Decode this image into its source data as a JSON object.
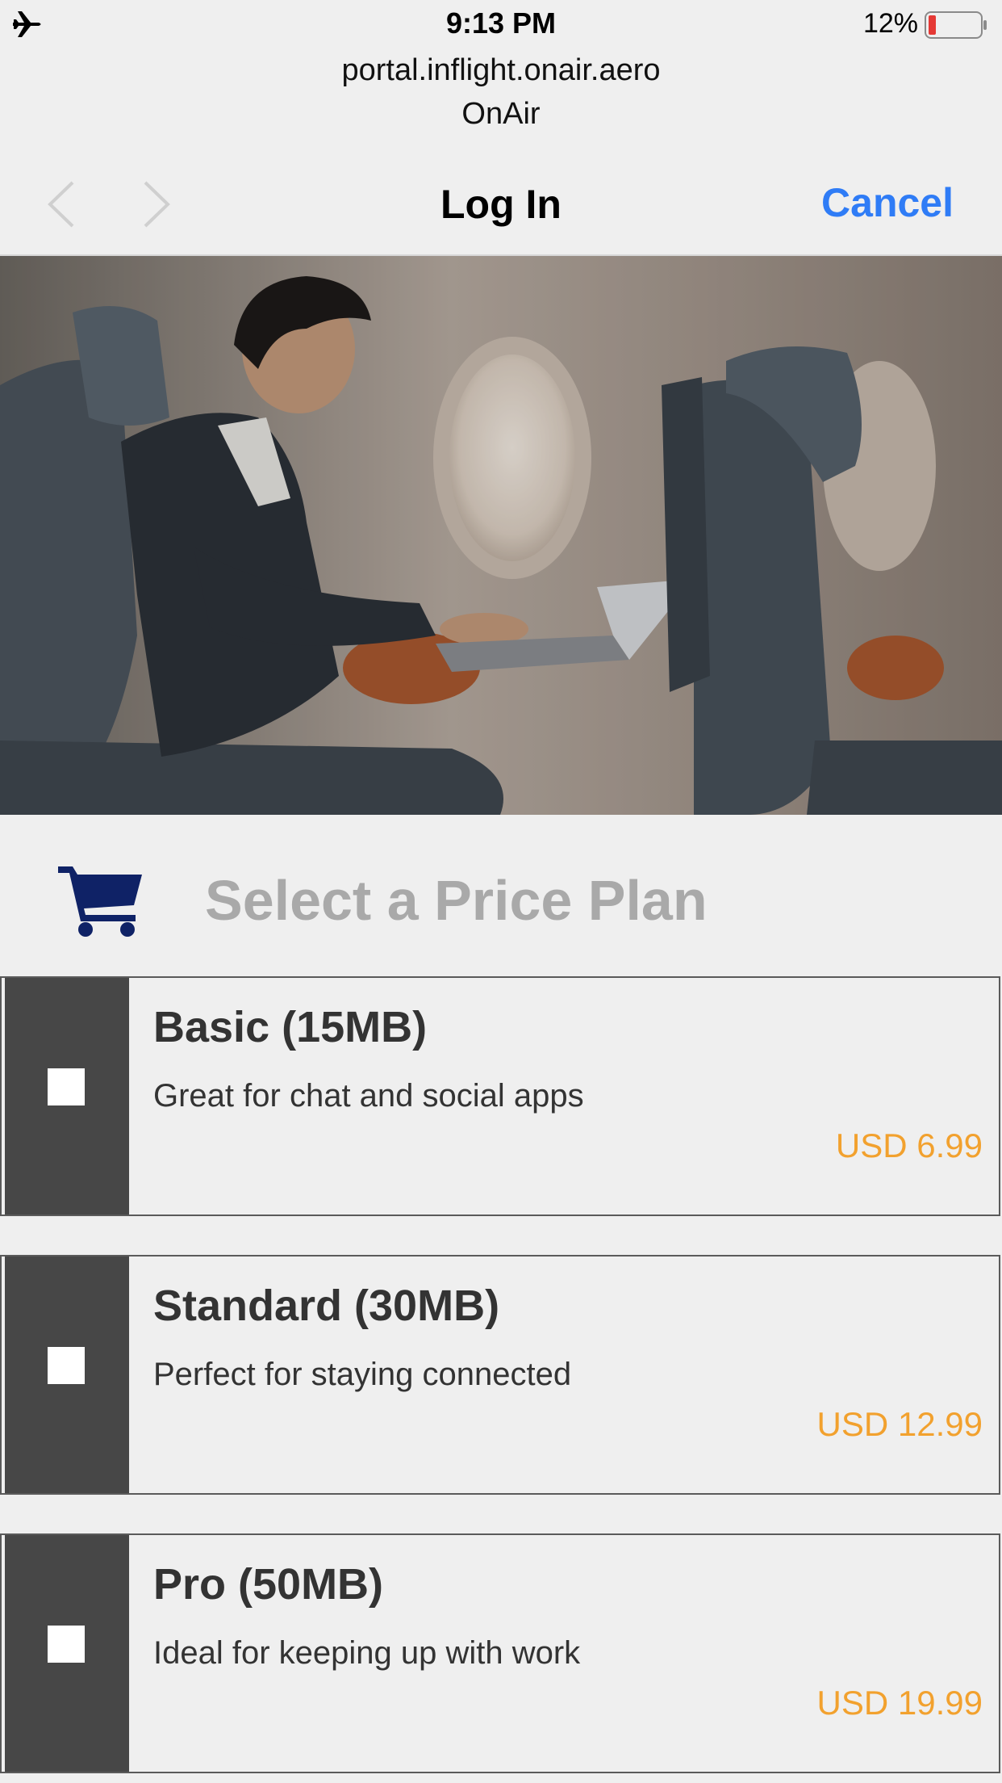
{
  "status": {
    "time": "9:13 PM",
    "battery": "12%"
  },
  "address": {
    "url": "portal.inflight.onair.aero",
    "site": "OnAir"
  },
  "nav": {
    "title": "Log In",
    "cancel": "Cancel"
  },
  "section": {
    "heading": "Select a Price Plan"
  },
  "colors": {
    "accent": "#2f7cf6",
    "price": "#f2a12e",
    "cart": "#0f2266",
    "plan_side": "#474747"
  },
  "plans": [
    {
      "name": "Basic (15MB)",
      "desc": "Great for chat and social apps",
      "price": "USD 6.99"
    },
    {
      "name": "Standard (30MB)",
      "desc": "Perfect for staying connected",
      "price": "USD 12.99"
    },
    {
      "name": "Pro (50MB)",
      "desc": "Ideal for keeping up with work",
      "price": "USD 19.99"
    }
  ]
}
